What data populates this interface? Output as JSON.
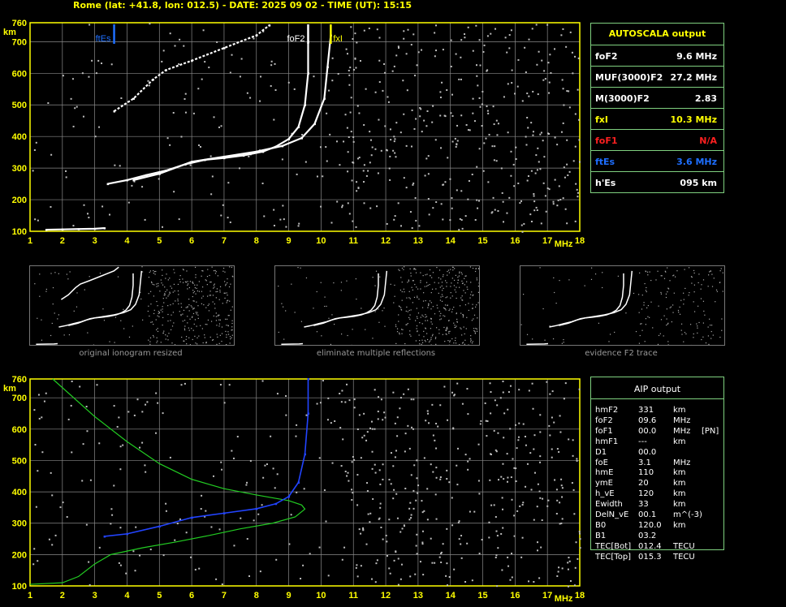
{
  "header": "Rome (lat: +41.8, lon: 012.5) - DATE: 2025 09 02 - TIME (UT): 15:15",
  "colors": {
    "grid": "#8a8a8a",
    "axis": "#ffff00",
    "panel_border": "#7fd07f",
    "trace": "#ffffff",
    "fof2_marker": "#ffffff",
    "fxi_marker": "#ffff00",
    "ftes_marker": "#1e6fff",
    "aip_profile": "#22cc22",
    "aip_trace": "#2244ff",
    "fof1": "#ff2020"
  },
  "axes": {
    "y_unit": "km",
    "x_unit": "MHz",
    "y_ticks": [
      "760",
      "700",
      "600",
      "500",
      "400",
      "300",
      "200",
      "100"
    ],
    "x_ticks": [
      "1",
      "2",
      "3",
      "4",
      "5",
      "6",
      "7",
      "8",
      "9",
      "10",
      "11",
      "12",
      "13",
      "14",
      "15",
      "16",
      "17",
      "18"
    ]
  },
  "chart_data": [
    {
      "type": "scatter",
      "panel": "autoscala-ionogram",
      "xlim": [
        1,
        18
      ],
      "ylim": [
        100,
        760
      ],
      "grid": true,
      "markers": [
        {
          "label": "ftEs",
          "x": 3.6
        },
        {
          "label": "foF2",
          "x": 9.6
        },
        {
          "label": "fxI",
          "x": 10.3
        }
      ],
      "series": [
        {
          "name": "O trace",
          "points": [
            [
              3.4,
              250
            ],
            [
              4.0,
              262
            ],
            [
              4.6,
              278
            ],
            [
              5.2,
              292
            ],
            [
              5.8,
              312
            ],
            [
              6.4,
              326
            ],
            [
              7.0,
              332
            ],
            [
              7.6,
              340
            ],
            [
              8.2,
              352
            ],
            [
              8.6,
              368
            ],
            [
              9.0,
              392
            ],
            [
              9.3,
              430
            ],
            [
              9.5,
              500
            ],
            [
              9.6,
              600
            ],
            [
              9.6,
              700
            ]
          ]
        },
        {
          "name": "X trace",
          "points": [
            [
              4.2,
              262
            ],
            [
              5.0,
              282
            ],
            [
              6.0,
              320
            ],
            [
              7.0,
              336
            ],
            [
              8.0,
              352
            ],
            [
              8.8,
              370
            ],
            [
              9.4,
              395
            ],
            [
              9.8,
              440
            ],
            [
              10.1,
              520
            ],
            [
              10.2,
              620
            ],
            [
              10.3,
              720
            ]
          ]
        },
        {
          "name": "multiple reflection",
          "points": [
            [
              3.6,
              480
            ],
            [
              4.2,
              520
            ],
            [
              4.8,
              580
            ],
            [
              5.2,
              610
            ],
            [
              6.0,
              640
            ],
            [
              7.0,
              680
            ],
            [
              8.0,
              720
            ],
            [
              8.4,
              752
            ]
          ]
        },
        {
          "name": "Es",
          "points": [
            [
              1.5,
              105
            ],
            [
              2.0,
              106
            ],
            [
              2.5,
              107
            ],
            [
              3.0,
              108
            ],
            [
              3.3,
              110
            ]
          ]
        }
      ]
    },
    {
      "type": "line",
      "panel": "aip-ionogram",
      "xlim": [
        1,
        18
      ],
      "ylim": [
        100,
        760
      ],
      "grid": true,
      "series": [
        {
          "name": "profile",
          "points": [
            [
              1.7,
              760
            ],
            [
              3.0,
              640
            ],
            [
              4.0,
              560
            ],
            [
              5.0,
              490
            ],
            [
              6.0,
              440
            ],
            [
              7.0,
              410
            ],
            [
              8.0,
              390
            ],
            [
              9.0,
              372
            ],
            [
              9.4,
              358
            ],
            [
              9.5,
              345
            ],
            [
              9.2,
              320
            ],
            [
              8.5,
              300
            ],
            [
              7.5,
              282
            ],
            [
              6.5,
              260
            ],
            [
              5.5,
              240
            ],
            [
              4.5,
              222
            ],
            [
              3.5,
              200
            ],
            [
              3.0,
              170
            ],
            [
              2.5,
              130
            ],
            [
              2.0,
              110
            ],
            [
              1.0,
              105
            ]
          ]
        },
        {
          "name": "AIP trace",
          "points": [
            [
              3.3,
              258
            ],
            [
              4.0,
              266
            ],
            [
              5.0,
              290
            ],
            [
              6.0,
              318
            ],
            [
              7.0,
              332
            ],
            [
              8.0,
              346
            ],
            [
              8.6,
              362
            ],
            [
              9.0,
              385
            ],
            [
              9.3,
              430
            ],
            [
              9.5,
              520
            ],
            [
              9.6,
              650
            ],
            [
              9.6,
              760
            ]
          ]
        }
      ]
    }
  ],
  "autoscala": {
    "title": "AUTOSCALA output",
    "rows": [
      {
        "label": "foF2",
        "value": "9.6 MHz",
        "color": "#ffffff"
      },
      {
        "label": "MUF(3000)F2",
        "value": "27.2 MHz",
        "color": "#ffffff"
      },
      {
        "label": "M(3000)F2",
        "value": "2.83",
        "color": "#ffffff"
      },
      {
        "label": "fxI",
        "value": "10.3 MHz",
        "color": "#ffff00"
      },
      {
        "label": "foF1",
        "value": "N/A",
        "color": "#ff2020"
      },
      {
        "label": "ftEs",
        "value": "3.6 MHz",
        "color": "#1e6fff"
      },
      {
        "label": "h'Es",
        "value": "095     km",
        "color": "#ffffff"
      }
    ]
  },
  "thumbnails": [
    {
      "caption": "original ionogram resized"
    },
    {
      "caption": "eliminate multiple reflections"
    },
    {
      "caption": "evidence F2 trace"
    }
  ],
  "aip": {
    "title": "AIP output",
    "rows": [
      [
        "hmF2",
        "331",
        "km",
        ""
      ],
      [
        "foF2",
        "09.6",
        "MHz",
        ""
      ],
      [
        "foF1",
        "00.0",
        "MHz",
        "[PN]"
      ],
      [
        "hmF1",
        "---",
        "km",
        ""
      ],
      [
        "D1",
        "00.0",
        "",
        ""
      ],
      [
        "foE",
        "3.1",
        "MHz",
        ""
      ],
      [
        "hmE",
        "110",
        "km",
        ""
      ],
      [
        "ymE",
        "20",
        "km",
        ""
      ],
      [
        "h_vE",
        "120",
        "km",
        ""
      ],
      [
        "Ewidth",
        "33",
        "km",
        ""
      ],
      [
        "DelN_vE",
        "00.1",
        "m^(-3)",
        ""
      ],
      [
        "B0",
        "120.0",
        "km",
        ""
      ],
      [
        "B1",
        "03.2",
        "",
        ""
      ],
      [
        "TEC[Bot]",
        "012.4",
        "TECU",
        ""
      ],
      [
        "TEC[Top]",
        "015.3",
        "TECU",
        ""
      ]
    ]
  }
}
